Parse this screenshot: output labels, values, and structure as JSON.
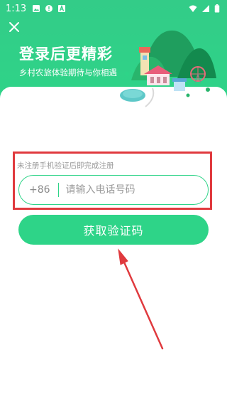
{
  "status_bar": {
    "time": "1:13",
    "icons": [
      "photo-icon",
      "alert-icon",
      "font-icon"
    ],
    "right_icons": [
      "wifi-icon",
      "signal-icon",
      "battery-icon"
    ]
  },
  "header": {
    "title": "登录后更精彩",
    "subtitle": "乡村农旅体验期待与你相遇",
    "close_icon": "close-icon",
    "illustration": "village-illustration"
  },
  "form": {
    "hint": "未注册手机验证后即完成注册",
    "country_code": "+86",
    "phone_placeholder": "请输入电话号码",
    "phone_value": "",
    "submit_label": "获取验证码"
  },
  "colors": {
    "brand_green": "#2ed488",
    "annotation_red": "#e03a3e",
    "hint_gray": "#9a9a9a"
  }
}
